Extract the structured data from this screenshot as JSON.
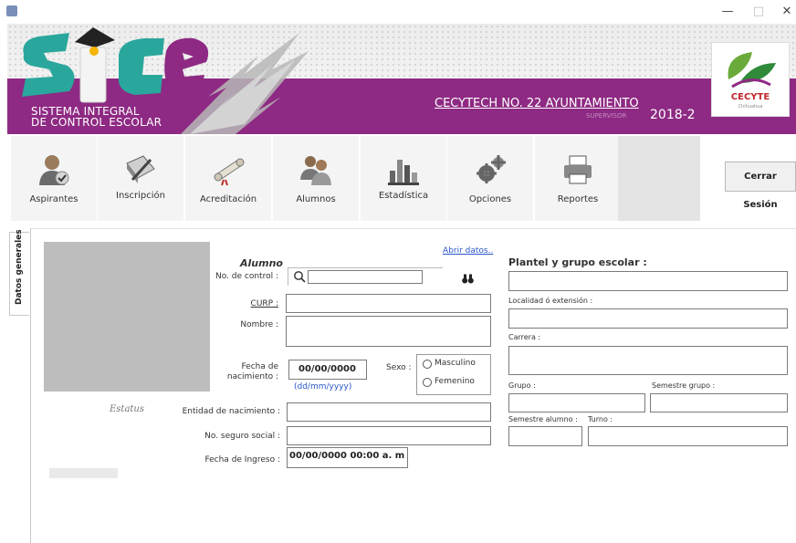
{
  "window": {
    "minimize": "—",
    "maximize": "□",
    "close": "✕"
  },
  "banner": {
    "system_name_line1": "SISTEMA INTEGRAL",
    "system_name_line2": "DE CONTROL ESCOLAR",
    "school": "CECYTECH NO. 22 AYUNTAMIENTO",
    "role": "SUPERVISOR",
    "period": "2018-2",
    "cecyte_name": "CECYTE",
    "cecyte_sub": "Chihuahua"
  },
  "toolbar": {
    "items": [
      {
        "label": "Aspirantes",
        "icon": "user-check-icon"
      },
      {
        "label": "Inscripción",
        "icon": "book-pen-icon"
      },
      {
        "label": "Acreditación",
        "icon": "scroll-diploma-icon"
      },
      {
        "label": "Alumnos",
        "icon": "users-icon"
      },
      {
        "label": "Estadística",
        "icon": "bar-chart-icon"
      },
      {
        "label": "Opciones",
        "icon": "gears-icon"
      },
      {
        "label": "Reportes",
        "icon": "printer-icon"
      }
    ],
    "logout": "Cerrar Sesión"
  },
  "tabs": {
    "general": "Datos generales"
  },
  "form": {
    "open_data": "Abrir datos..",
    "student_heading": "Alumno",
    "control_no_label": "No. de control :",
    "control_no_value": "",
    "curp_label": "CURP :",
    "name_label": "Nombre :",
    "birth_label_1": "Fecha de",
    "birth_label_2": "nacimiento :",
    "birth_value": "00/00/0000",
    "birth_format": "(dd/mm/yyyy)",
    "sex_label": "Sexo :",
    "male": "Masculino",
    "female": "Femenino",
    "status_label": "Estatus",
    "birth_state_label": "Entidad de nacimiento :",
    "ssn_label": "No. seguro social :",
    "entry_date_label": "Fecha de Ingreso :",
    "entry_date_value": "00/00/0000 00:00 a. m"
  },
  "school_panel": {
    "heading": "Plantel  y grupo escolar :",
    "locality_label": "Localidad ó extensión :",
    "career_label": "Carrera :",
    "group_label": "Grupo :",
    "group_semester_label": "Semestre grupo :",
    "student_semester_label": "Semestre alumno :",
    "shift_label": "Turno :"
  }
}
